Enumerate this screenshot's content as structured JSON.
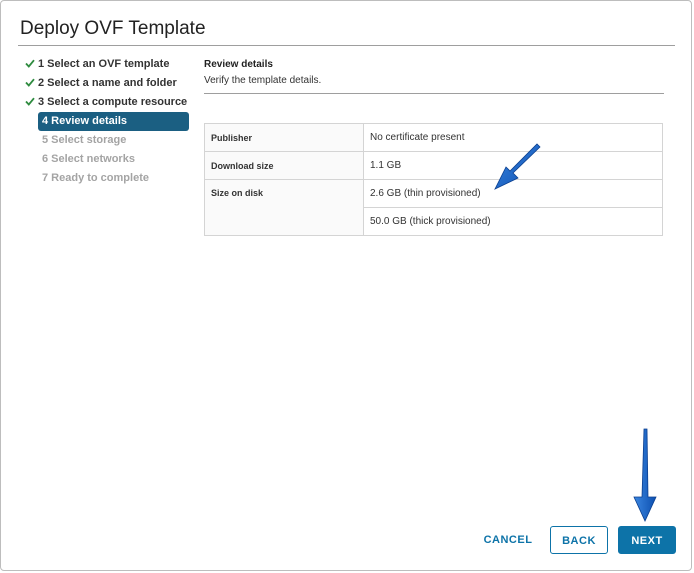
{
  "dialog": {
    "title": "Deploy OVF Template"
  },
  "steps": [
    {
      "label": "1 Select an OVF template",
      "state": "done"
    },
    {
      "label": "2 Select a name and folder",
      "state": "done"
    },
    {
      "label": "3 Select a compute resource",
      "state": "done"
    },
    {
      "label": "4 Review details",
      "state": "active"
    },
    {
      "label": "5 Select storage",
      "state": "pending"
    },
    {
      "label": "6 Select networks",
      "state": "pending"
    },
    {
      "label": "7 Ready to complete",
      "state": "pending"
    }
  ],
  "content": {
    "heading": "Review details",
    "subheading": "Verify the template details.",
    "rows": {
      "publisher": {
        "key": "Publisher",
        "value": "No certificate present"
      },
      "download_size": {
        "key": "Download size",
        "value": "1.1 GB"
      },
      "size_on_disk": {
        "key": "Size on disk",
        "value_thin": "2.6 GB (thin provisioned)",
        "value_thick": "50.0 GB (thick provisioned)"
      }
    }
  },
  "buttons": {
    "cancel": "CANCEL",
    "back": "BACK",
    "next": "NEXT"
  },
  "colors": {
    "accent": "#0d73a8",
    "active_step": "#1b5f82",
    "check": "#2e8b3f",
    "annotation_arrow": "#1a5fc4"
  }
}
